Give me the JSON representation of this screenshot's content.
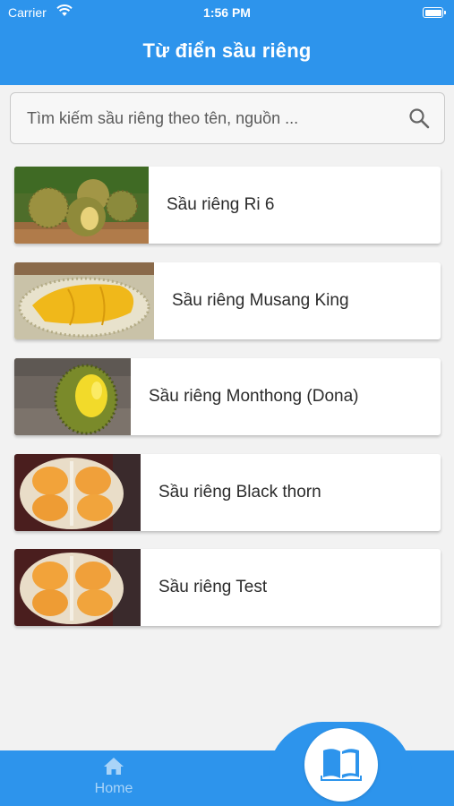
{
  "status_bar": {
    "carrier": "Carrier",
    "time": "1:56 PM"
  },
  "app_bar": {
    "title": "Từ điển sầu riêng",
    "color": "#2d94ec"
  },
  "search": {
    "placeholder": "Tìm kiếm sầu riêng theo tên, nguồn ...",
    "value": ""
  },
  "durians": [
    {
      "name": "Sầu riêng Ri 6",
      "image": "durian-fruits-photo"
    },
    {
      "name": "Sầu riêng Musang King",
      "image": "musang-king-photo"
    },
    {
      "name": "Sầu riêng Monthong (Dona)",
      "image": "monthong-photo"
    },
    {
      "name": "Sầu riêng Black thorn",
      "image": "black-thorn-photo"
    },
    {
      "name": "Sầu riêng Test",
      "image": "test-durian-photo"
    }
  ],
  "bottom_nav": {
    "home_label": "Home",
    "active_icon": "book-icon"
  }
}
